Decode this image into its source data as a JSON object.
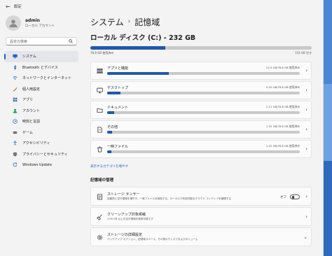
{
  "window": {
    "title": "設定"
  },
  "profile": {
    "name": "admin",
    "account": "ローカル アカウント"
  },
  "search": {
    "placeholder": "設定の検索"
  },
  "sidebar": {
    "items": [
      {
        "label": "システム",
        "icon": "system-icon",
        "color": "#1a64c8",
        "active": true
      },
      {
        "label": "Bluetooth とデバイス",
        "icon": "bluetooth-icon",
        "color": "#1a64c8"
      },
      {
        "label": "ネットワークとインターネット",
        "icon": "network-icon",
        "color": "#2b6fc9"
      },
      {
        "label": "個人用設定",
        "icon": "brush-icon",
        "color": "#c9782b"
      },
      {
        "label": "アプリ",
        "icon": "apps-icon",
        "color": "#3b6ea5"
      },
      {
        "label": "アカウント",
        "icon": "account-icon",
        "color": "#2c9c5e"
      },
      {
        "label": "時刻と言語",
        "icon": "time-language-icon",
        "color": "#1a64c8"
      },
      {
        "label": "ゲーム",
        "icon": "game-icon",
        "color": "#555555"
      },
      {
        "label": "アクセシビリティ",
        "icon": "accessibility-icon",
        "color": "#2b6fc9"
      },
      {
        "label": "プライバシーとセキュリティ",
        "icon": "shield-icon",
        "color": "#777777"
      },
      {
        "label": "Windows Update",
        "icon": "update-icon",
        "color": "#1a64c8"
      }
    ]
  },
  "breadcrumb": {
    "parent": "システム",
    "separator": "›",
    "current": "記憶域"
  },
  "disk": {
    "title": "ローカル ディスク (C:) - 232 GB",
    "used_label": "78.8 GB 使用済み",
    "free_label": "153 GB 空き",
    "used_fraction": 0.34
  },
  "categories": [
    {
      "label": "アプリと機能",
      "used": "24.9 GB/78.8 GB 使用済み",
      "fraction": 0.32,
      "icon": "apps-list-icon"
    },
    {
      "label": "デスクトップ",
      "used": "5.20 GB/78.8 GB 使用済み",
      "fraction": 0.07,
      "icon": "desktop-icon"
    },
    {
      "label": "ドキュメント",
      "used": "2.51 GB/78.8 GB 使用済み",
      "fraction": 0.035,
      "icon": "documents-icon"
    },
    {
      "label": "その他",
      "used": "1.55 GB/78.8 GB 使用済み",
      "fraction": 0.025,
      "icon": "folder-icon"
    },
    {
      "label": "一時ファイル",
      "used": "1.22 GB/78.8 GB 使用済み",
      "fraction": 0.02,
      "icon": "trash-icon"
    }
  ],
  "more_link": "表示するカテゴリを増やす",
  "management": {
    "title": "記憶域の管理",
    "rows": [
      {
        "title": "ストレージ センサー",
        "desc": "自動的に空き領域を増やす、一時ファイルを削除する、ローカルで利用可能なクラウド コンテンツを管理する",
        "toggle_label": "オフ",
        "icon": "storage-sense-icon"
      },
      {
        "title": "クリーンアップ対象候補",
        "desc": "1.00 GB 以上の空き領域を使用可能です",
        "icon": "broom-icon"
      },
      {
        "title": "ストレージの詳細設定",
        "desc": "バックアップ オプション、記憶域スペース、その他のディスクおよびボリューム",
        "icon": "gear-icon"
      }
    ]
  },
  "chevron": "›",
  "chevron_down": "⌄"
}
